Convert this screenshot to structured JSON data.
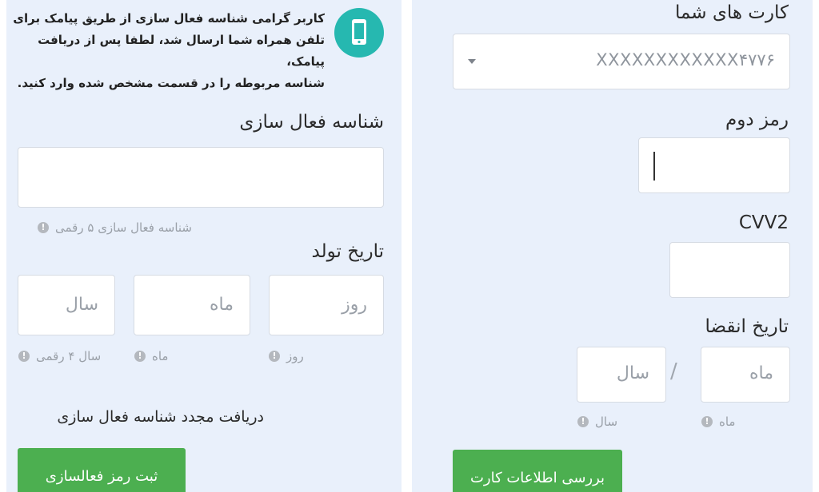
{
  "left": {
    "message": {
      "lines": [
        "کاربر گرامی شناسه فعال سازی از طریق پیامک برای",
        "تلفن همراه شما ارسال شد، لطفا پس از دریافت پیامک،",
        "شناسه مربوطه را در قسمت مشخص شده وارد کنید."
      ]
    },
    "activation": {
      "label": "شناسه فعال سازی",
      "hint": "شناسه فعال سازی ۵ رقمی"
    },
    "birth": {
      "label": "تاریخ تولد",
      "day_placeholder": "روز",
      "month_placeholder": "ماه",
      "year_placeholder": "سال",
      "day_hint": "روز",
      "month_hint": "ماه",
      "year_hint": "سال ۴ رقمی"
    },
    "resend_link": "دریافت مجدد شناسه فعال سازی",
    "submit_button": "ثبت رمز فعالسازی"
  },
  "right": {
    "cards": {
      "label": "کارت های شما",
      "selected": "XXXXXXXXXXXX۴۷۷۶"
    },
    "second_password": {
      "label": "رمز دوم",
      "value": ""
    },
    "cvv2": {
      "label": "CVV2",
      "value": ""
    },
    "expiry": {
      "label": "تاریخ انقضا",
      "month_placeholder": "ماه",
      "year_placeholder": "سال",
      "separator": "/",
      "month_hint": "ماه",
      "year_hint": "سال"
    },
    "check_button": "بررسی اطلاعات کارت"
  },
  "icons": {
    "info": "info-icon",
    "phone": "mobile-phone-icon",
    "dropdown": "caret-down-icon"
  },
  "colors": {
    "accent_green": "#4caf50",
    "phone_icon_bg": "#26b8b0",
    "panel_bg": "#e9f0fb"
  }
}
